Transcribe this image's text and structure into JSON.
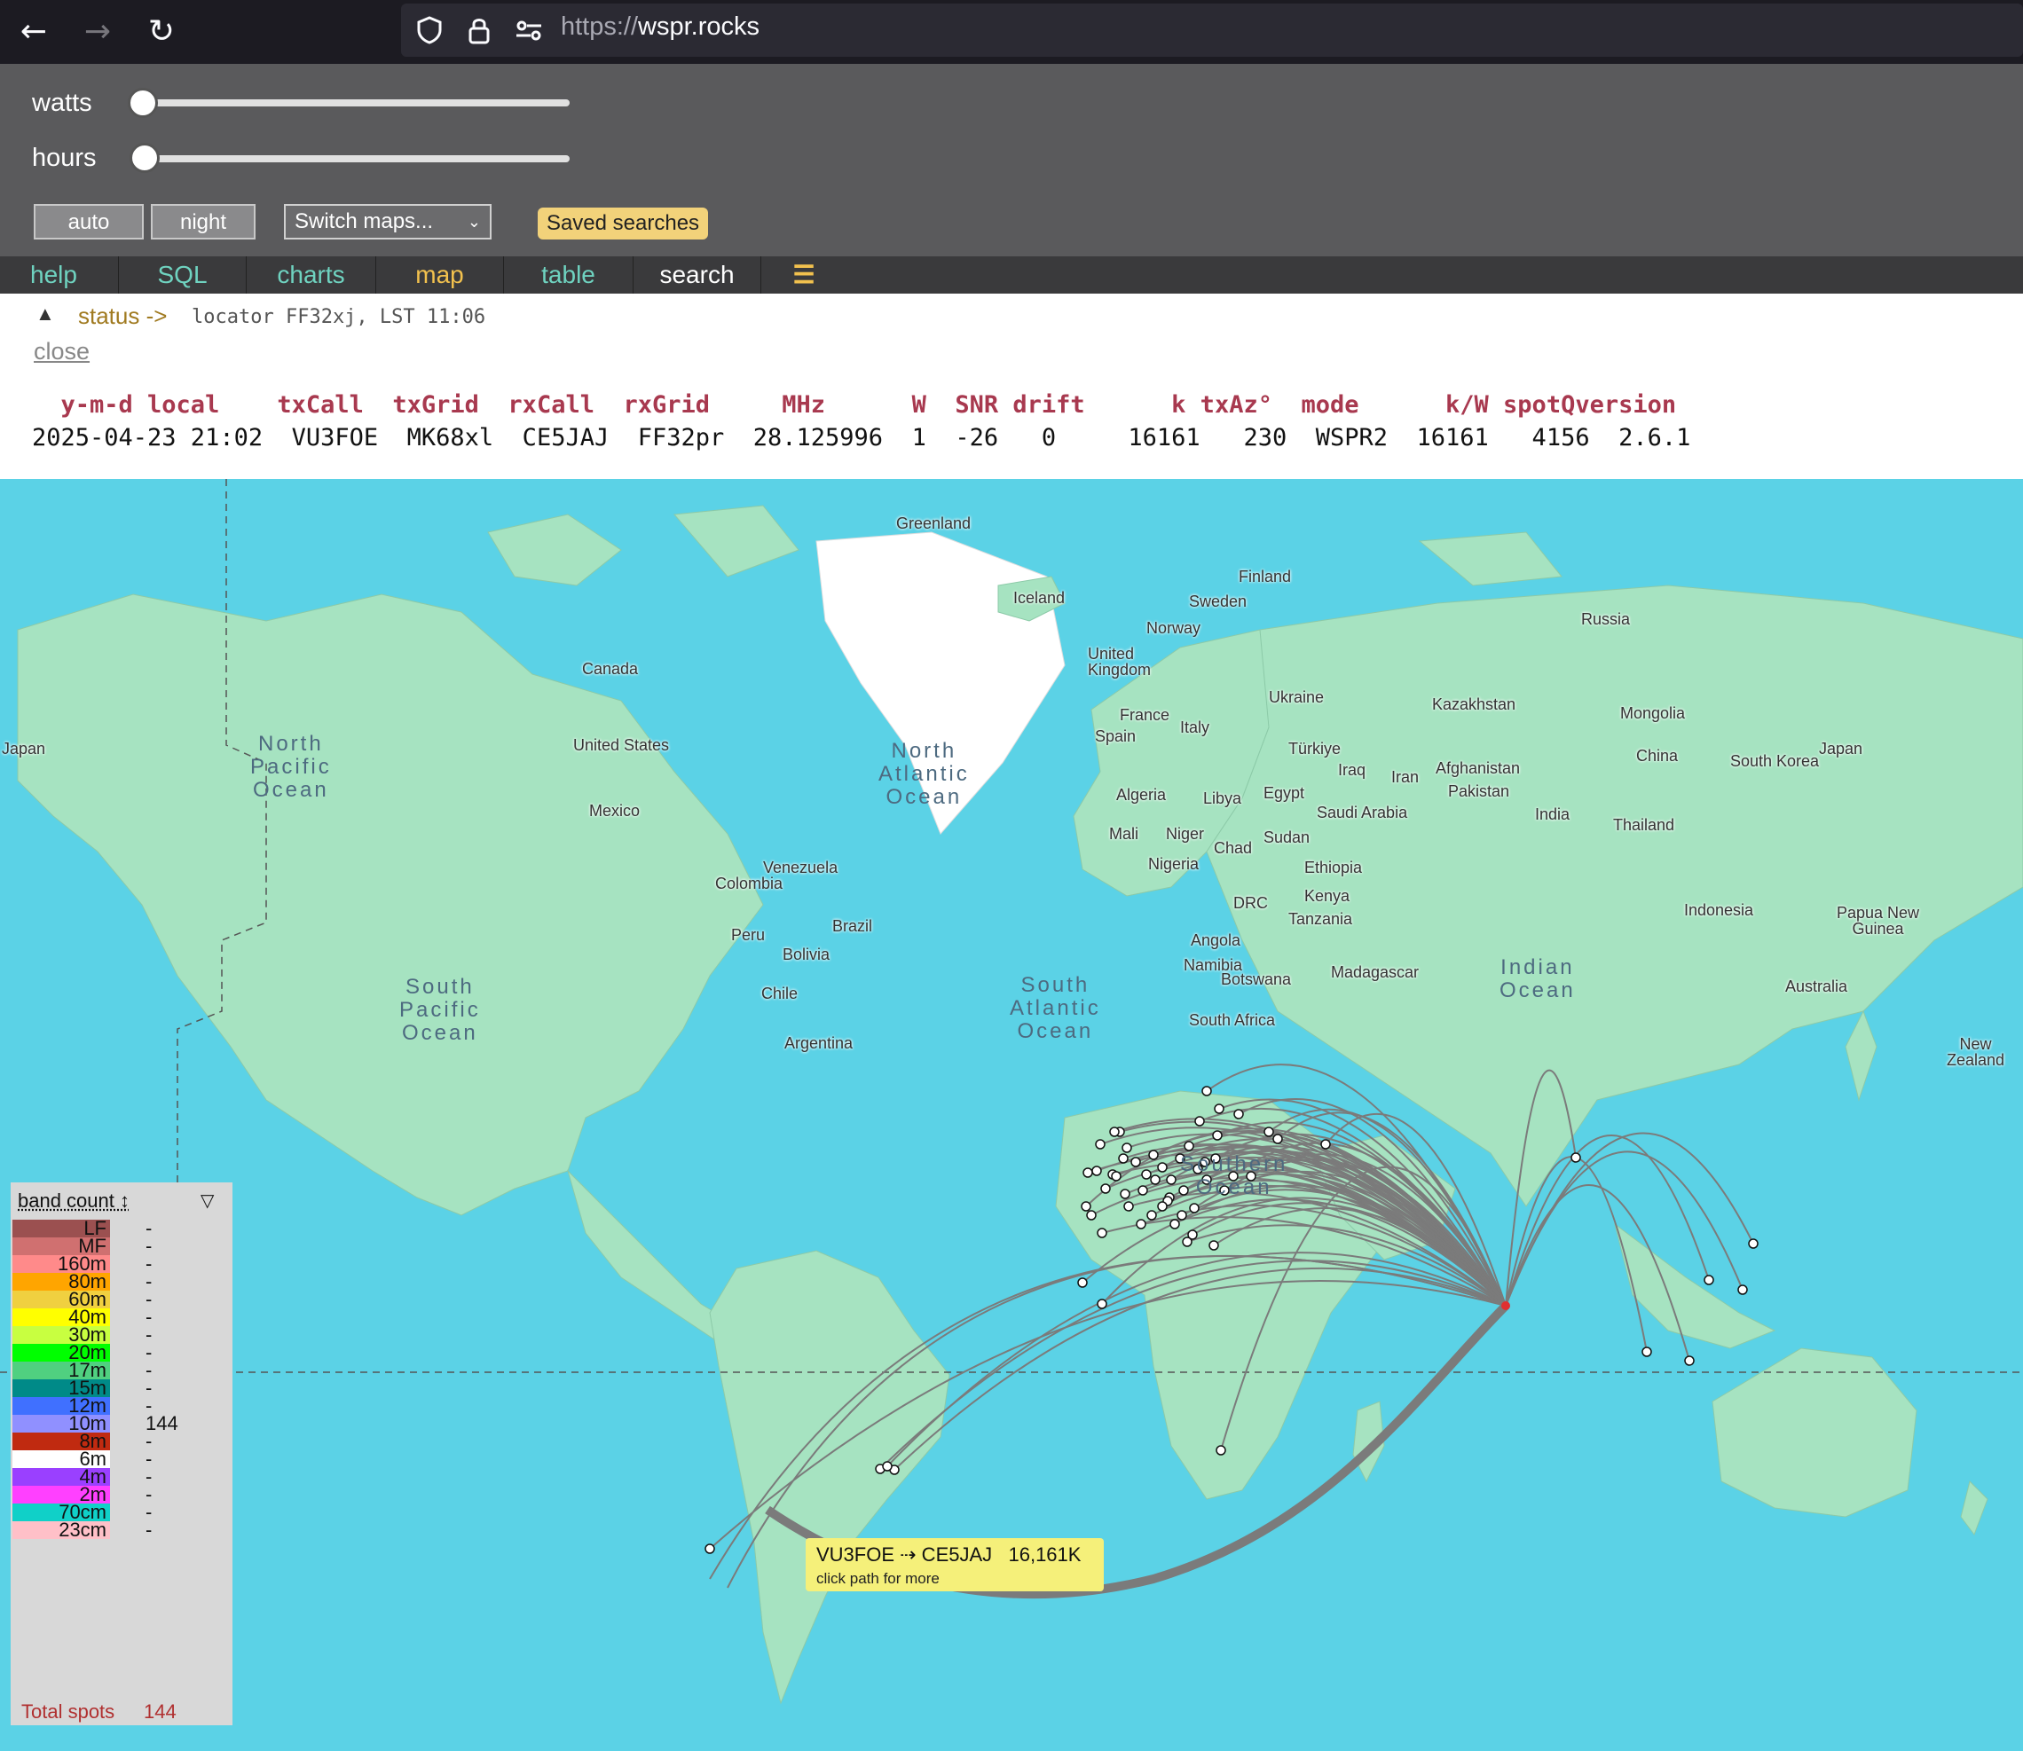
{
  "browser": {
    "url_scheme": "https://",
    "url_host": "wspr.rocks"
  },
  "controls": {
    "watts_label": "watts",
    "hours_label": "hours",
    "watts_value": 0,
    "hours_value": 0,
    "auto_label": "auto",
    "night_label": "night",
    "switch_maps_label": "Switch maps...",
    "saved_searches_label": "Saved searches"
  },
  "tabs": [
    {
      "label": "help",
      "color": "#6fd3c0"
    },
    {
      "label": "SQL",
      "color": "#6fd3c0"
    },
    {
      "label": "charts",
      "color": "#6fd3c0"
    },
    {
      "label": "map",
      "color": "#f2c14e"
    },
    {
      "label": "table",
      "color": "#6fd3c0"
    },
    {
      "label": "search",
      "color": "#ffffff"
    },
    {
      "label": "☰",
      "color": "#f2c14e"
    }
  ],
  "status": {
    "arrow": "▲",
    "label": "status ->",
    "text": "locator FF32xj, LST 11:06",
    "close_label": "close"
  },
  "spot_table": {
    "headers": "  y-m-d local    txCall  txGrid  rxCall  rxGrid     MHz      W  SNR drift      k txAz°  mode      k/W spotQversion",
    "row": "2025-04-23 21:02  VU3FOE  MK68xl  CE5JAJ  FF32pr  28.125996  1  -26   0     16161   230  WSPR2  16161   4156  2.6.1"
  },
  "map": {
    "labels": {
      "greenland": "Greenland",
      "iceland": "Iceland",
      "finland": "Finland",
      "sweden": "Sweden",
      "norway": "Norway",
      "russia": "Russia",
      "uk": "United\nKingdom",
      "canada": "Canada",
      "us": "United States",
      "mexico": "Mexico",
      "kazakhstan": "Kazakhstan",
      "mongolia": "Mongolia",
      "china": "China",
      "japan_r": "Japan",
      "japan_l": "Japan",
      "south_korea": "South Korea",
      "france": "France",
      "spain": "Spain",
      "italy": "Italy",
      "turkiye": "Türkiye",
      "ukraine": "Ukraine",
      "iraq": "Iraq",
      "iran": "Iran",
      "afghanistan": "Afghanistan",
      "pakistan": "Pakistan",
      "india": "India",
      "thailand": "Thailand",
      "algeria": "Algeria",
      "libya": "Libya",
      "egypt": "Egypt",
      "saudi": "Saudi Arabia",
      "mali": "Mali",
      "niger": "Niger",
      "chad": "Chad",
      "sudan": "Sudan",
      "nigeria": "Nigeria",
      "ethiopia": "Ethiopia",
      "kenya": "Kenya",
      "drc": "DRC",
      "tanzania": "Tanzania",
      "angola": "Angola",
      "namibia": "Namibia",
      "botswana": "Botswana",
      "madagascar": "Madagascar",
      "south_africa": "South Africa",
      "venezuela": "Venezuela",
      "colombia": "Colombia",
      "peru": "Peru",
      "brazil": "Brazil",
      "bolivia": "Bolivia",
      "chile": "Chile",
      "argentina": "Argentina",
      "indonesia": "Indonesia",
      "png": "Papua New\nGuinea",
      "australia": "Australia",
      "nz": "New\nZealand"
    },
    "oceans": {
      "north_pacific": "North\nPacific\nOcean",
      "north_atlantic": "North\nAtlantic\nOcean",
      "south_pacific": "South\nPacific\nOcean",
      "south_atlantic": "South\nAtlantic\nOcean",
      "indian": "Indian\nOcean",
      "southern": "Southern\nOcean"
    },
    "tooltip": {
      "path": "VU3FOE ⇢ CE5JAJ   16,161K",
      "hint": "click path for more"
    }
  },
  "legend": {
    "header": "band count ↕",
    "filter_icon": "▽",
    "bands": [
      {
        "band": "LF",
        "count": "-",
        "color": "#9b5050"
      },
      {
        "band": "MF",
        "count": "-",
        "color": "#d07070"
      },
      {
        "band": "160m",
        "count": "-",
        "color": "#ff8a8a"
      },
      {
        "band": "80m",
        "count": "-",
        "color": "#ffa500"
      },
      {
        "band": "60m",
        "count": "-",
        "color": "#f0d040"
      },
      {
        "band": "40m",
        "count": "-",
        "color": "#ffff00"
      },
      {
        "band": "30m",
        "count": "-",
        "color": "#c8ff40"
      },
      {
        "band": "20m",
        "count": "-",
        "color": "#00ff00"
      },
      {
        "band": "17m",
        "count": "-",
        "color": "#50d080"
      },
      {
        "band": "15m",
        "count": "-",
        "color": "#008a88"
      },
      {
        "band": "12m",
        "count": "-",
        "color": "#4070ff"
      },
      {
        "band": "10m",
        "count": "144",
        "color": "#9090ff"
      },
      {
        "band": "8m",
        "count": "-",
        "color": "#c02a10"
      },
      {
        "band": "6m",
        "count": "-",
        "color": "#ffffff"
      },
      {
        "band": "4m",
        "count": "-",
        "color": "#9a40ff"
      },
      {
        "band": "2m",
        "count": "-",
        "color": "#ff40ff"
      },
      {
        "band": "70cm",
        "count": "-",
        "color": "#10d0c8"
      },
      {
        "band": "23cm",
        "count": "-",
        "color": "#ffc0c8"
      }
    ],
    "total_label": "Total spots",
    "total_value": "144"
  }
}
